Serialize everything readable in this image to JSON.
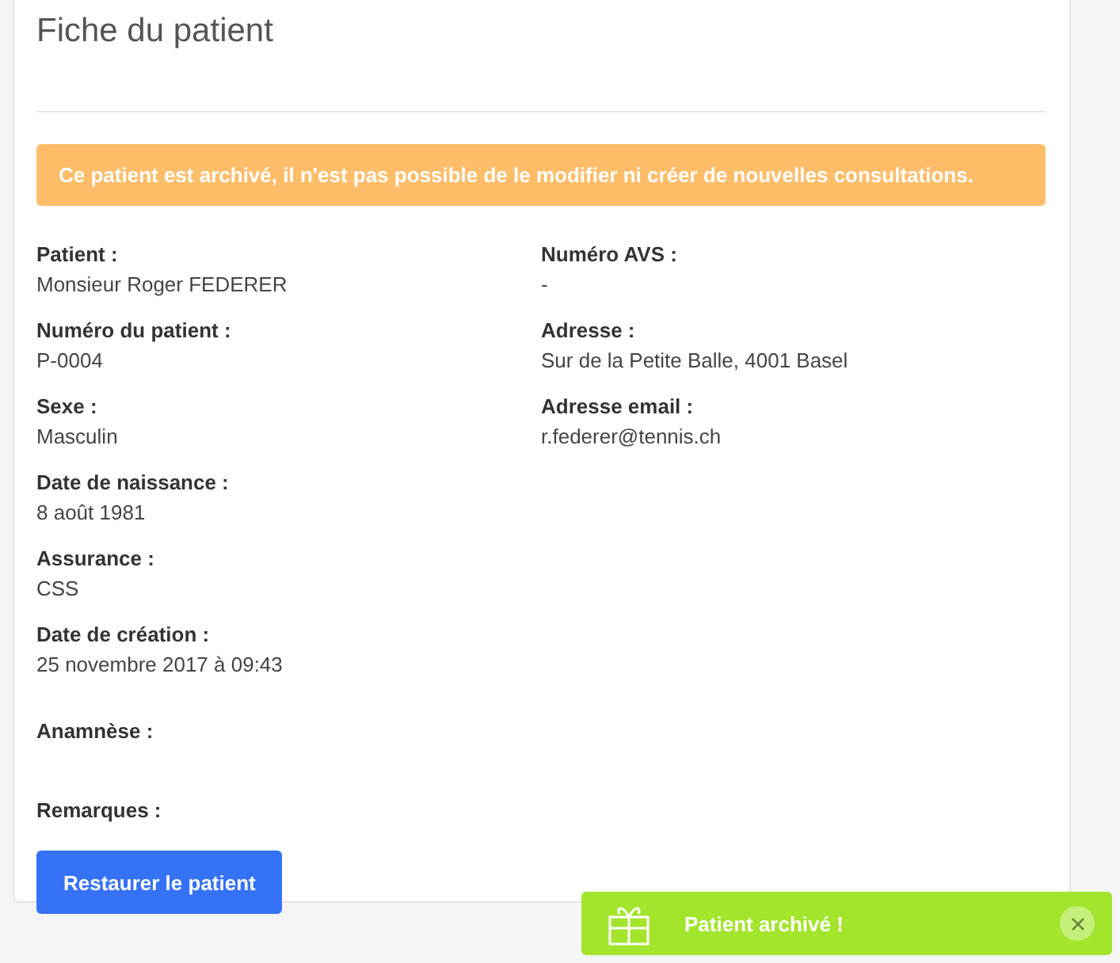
{
  "title": "Fiche du patient",
  "alert": "Ce patient est archivé, il n'est pas possible de le modifier ni créer de nouvelles consultations.",
  "columns": [
    [
      {
        "label": "Patient :",
        "value": "Monsieur Roger FEDERER"
      },
      {
        "label": "Numéro du patient :",
        "value": "P-0004"
      },
      {
        "label": "Sexe :",
        "value": "Masculin"
      },
      {
        "label": "Date de naissance :",
        "value": "8 août 1981"
      },
      {
        "label": "Assurance :",
        "value": "CSS"
      },
      {
        "label": "Date de création :",
        "value": "25 novembre 2017 à 09:43"
      }
    ],
    [
      {
        "label": "Numéro AVS :",
        "value": "-"
      },
      {
        "label": "Adresse :",
        "value": "Sur de la Petite Balle, 4001 Basel"
      },
      {
        "label": "Adresse email :",
        "value": "r.federer@tennis.ch"
      }
    ]
  ],
  "notes": [
    {
      "label": "Anamnèse :"
    },
    {
      "label": "Remarques :"
    }
  ],
  "button": "Restaurer le patient",
  "toast": {
    "message": "Patient archivé !"
  }
}
